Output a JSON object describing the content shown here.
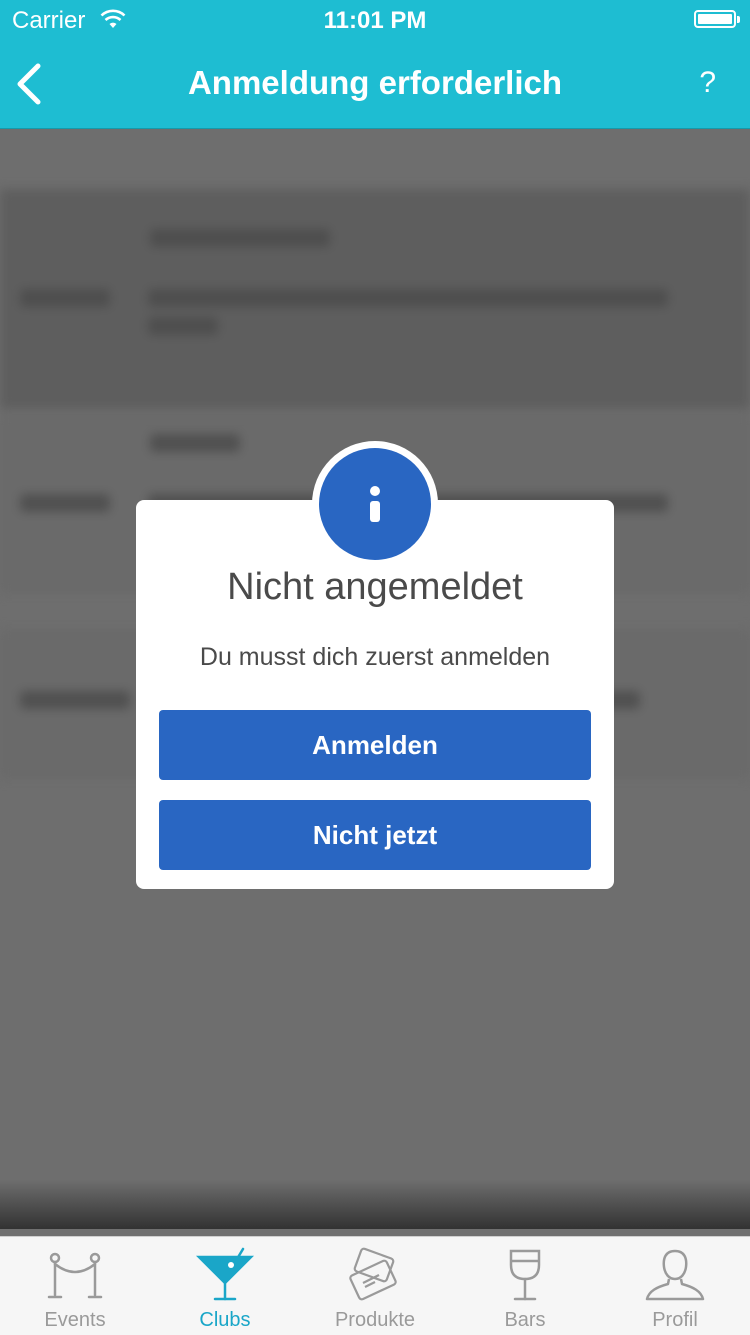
{
  "status_bar": {
    "carrier": "Carrier",
    "time": "11:01 PM"
  },
  "nav": {
    "title": "Anmeldung erforderlich",
    "help": "?"
  },
  "dialog": {
    "title": "Nicht angemeldet",
    "message": "Du musst dich zuerst anmelden",
    "primary_button": "Anmelden",
    "secondary_button": "Nicht jetzt",
    "icon": "info-icon"
  },
  "tabs": [
    {
      "label": "Events",
      "icon": "rope-barrier-icon",
      "active": false
    },
    {
      "label": "Clubs",
      "icon": "cocktail-glass-icon",
      "active": true
    },
    {
      "label": "Produkte",
      "icon": "ticket-cards-icon",
      "active": false
    },
    {
      "label": "Bars",
      "icon": "wine-glass-icon",
      "active": false
    },
    {
      "label": "Profil",
      "icon": "person-icon",
      "active": false
    }
  ],
  "colors": {
    "accent": "#1ebdd2",
    "button": "#2966c2",
    "active_tab": "#1aa6c8",
    "inactive_tab": "#9a9a9a"
  }
}
